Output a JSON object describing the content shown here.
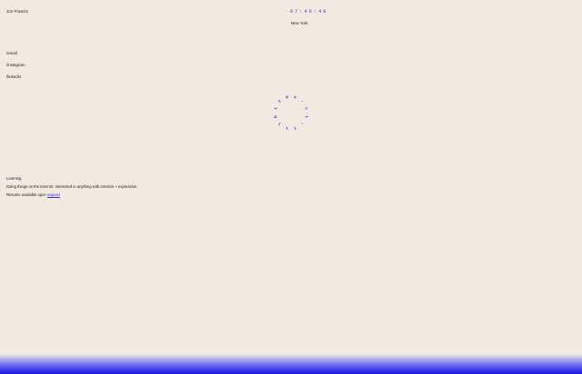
{
  "header": {
    "name": "Jon Francis",
    "clock": "07:46:40",
    "city": "New York"
  },
  "links": [
    {
      "label": "/email"
    },
    {
      "label": "/instagram"
    },
    {
      "label": "/linkedin"
    }
  ],
  "ring": {
    "text": "ds-ct-ltlbit"
  },
  "bio": {
    "line1": "Learning.",
    "line2": "Doing things on the internet. Interested in anything with emotion + expression.",
    "line3_prefix": "Resume available upon",
    "line3_link": "request"
  },
  "colors": {
    "background": "#f2eae0",
    "accent": "#2f2fd6",
    "gradient_bottom": "#1a14e6"
  }
}
